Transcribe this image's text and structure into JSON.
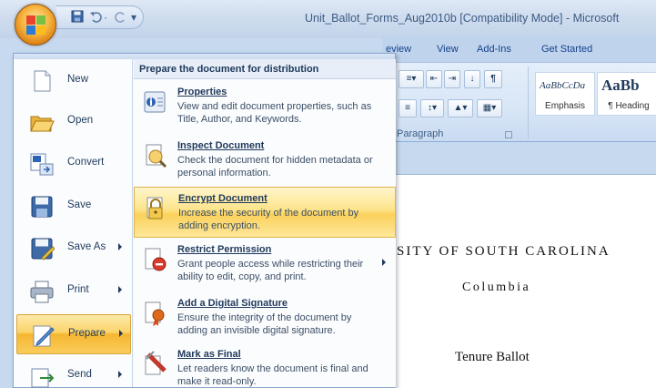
{
  "window": {
    "title": "Unit_Ballot_Forms_Aug2010b [Compatibility Mode] - Microsoft"
  },
  "qat": {
    "save_icon": "save-icon",
    "undo_icon": "undo-icon",
    "undo_dropdown": "·",
    "redo_icon": "redo-icon",
    "customize": "▾"
  },
  "ribbon": {
    "tabs": [
      "eview",
      "View",
      "Add-Ins",
      "Get Started"
    ],
    "paragraph_group_label": "Paragraph",
    "styles": [
      {
        "sample": "AaBbCcDa",
        "name": "Emphasis"
      },
      {
        "sample": "AaBb",
        "name": "¶ Heading"
      }
    ]
  },
  "office_menu": {
    "left_items": [
      {
        "label": "New",
        "icon": "new-document-icon",
        "has_submenu": false
      },
      {
        "label": "Open",
        "icon": "open-folder-icon",
        "has_submenu": false
      },
      {
        "label": "Convert",
        "icon": "convert-icon",
        "has_submenu": false
      },
      {
        "label": "Save",
        "icon": "save-icon",
        "has_submenu": false
      },
      {
        "label": "Save As",
        "icon": "save-as-icon",
        "has_submenu": true
      },
      {
        "label": "Print",
        "icon": "printer-icon",
        "has_submenu": true
      },
      {
        "label": "Prepare",
        "icon": "prepare-icon",
        "has_submenu": true,
        "active": true
      },
      {
        "label": "Send",
        "icon": "send-icon",
        "has_submenu": true
      }
    ],
    "submenu": {
      "title": "Prepare the document for distribution",
      "items": [
        {
          "title": "Properties",
          "desc": "View and edit document properties, such as Title, Author, and Keywords.",
          "icon": "properties-icon"
        },
        {
          "title": "Inspect Document",
          "desc": "Check the document for hidden metadata or personal information.",
          "icon": "inspect-document-icon"
        },
        {
          "title": "Encrypt Document",
          "desc": "Increase the security of the document by adding encryption.",
          "icon": "encrypt-lock-icon",
          "active": true
        },
        {
          "title": "Restrict Permission",
          "desc": "Grant people access while restricting their ability to edit, copy, and print.",
          "icon": "restrict-permission-icon",
          "has_submenu": true
        },
        {
          "title": "Add a Digital Signature",
          "desc": "Ensure the integrity of the document by adding an invisible digital signature.",
          "icon": "digital-signature-icon"
        },
        {
          "title": "Mark as Final",
          "desc": "Let readers know the document is final and make it read-only.",
          "icon": "mark-as-final-icon"
        }
      ]
    }
  },
  "document": {
    "line1": "RSITY OF SOUTH CAROLINA",
    "line2": "Columbia",
    "line3": "Tenure Ballot"
  },
  "colors": {
    "accent_highlight": "#fbd15c",
    "menu_text": "#1e395b",
    "ribbon_bg": "#d8e6f6"
  }
}
